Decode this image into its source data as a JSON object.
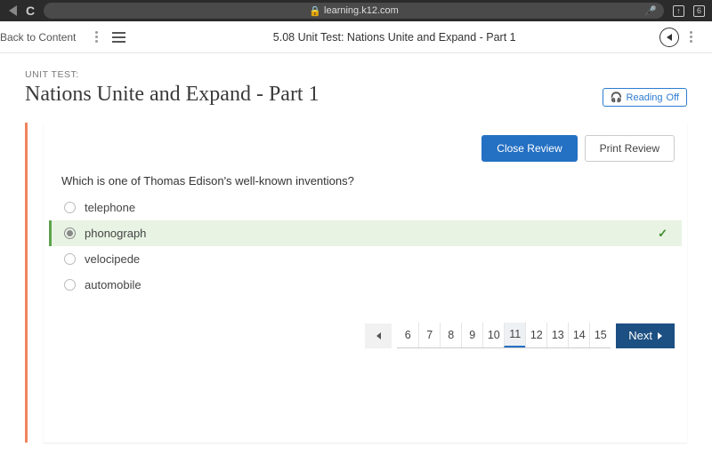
{
  "browser": {
    "url": "learning.k12.com"
  },
  "header": {
    "back_label": "Back to Content",
    "title": "5.08 Unit Test: Nations Unite and Expand - Part 1"
  },
  "title": {
    "kicker": "UNIT TEST:",
    "main": "Nations Unite and Expand - Part 1"
  },
  "reading": {
    "label": "Reading",
    "state": "Off"
  },
  "review": {
    "close_label": "Close Review",
    "print_label": "Print Review"
  },
  "question": {
    "prompt": "Which is one of Thomas Edison's well-known inventions?",
    "options": [
      {
        "label": "telephone",
        "selected": false
      },
      {
        "label": "phonograph",
        "selected": true
      },
      {
        "label": "velocipede",
        "selected": false
      },
      {
        "label": "automobile",
        "selected": false
      }
    ]
  },
  "pager": {
    "pages": [
      "6",
      "7",
      "8",
      "9",
      "10",
      "11",
      "12",
      "13",
      "14",
      "15"
    ],
    "current": "11",
    "next_label": "Next"
  }
}
